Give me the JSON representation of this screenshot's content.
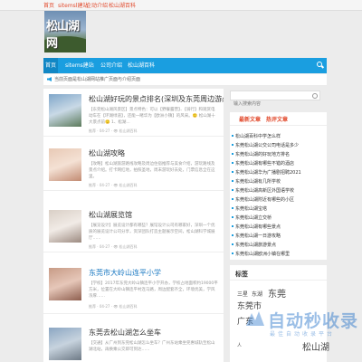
{
  "topbar": {
    "links": [
      "首页",
      "sitemsl建站",
      "企动介绍",
      "松山湖百科"
    ]
  },
  "logo": {
    "text": "松山湖网"
  },
  "nav": {
    "items": [
      "首页",
      "sitems建站",
      "公司介绍",
      "松山湖百科"
    ]
  },
  "notice": {
    "text": "当前页面是松山湖网站推广页面与介绍页面"
  },
  "posts": [
    {
      "title": "松山湖好玩的景点排名(深圳及东莞周边游必看)",
      "excerpt": "【东莞松山湖风景区】景点特色：可以【野餐露营】、【骑行】和观赏电动车在【环湖绿道】，还能一睹华为【欧洲小镇】的风采。🙂 松山湖十大景点前🙂 1、松湖...",
      "meta": "推荐 · 04-27 · 👁 松山湖百科"
    },
    {
      "title": "松山湖攻略",
      "excerpt": "【攻略】松山湖旅游路线攻略及周边住宿推荐与美食介绍，游玩路线及景点介绍。打卡网红地，拍照圣地，周末游玩好去处，门票信息全在这里。",
      "meta": "推荐 · 04-27 · 👁 松山湖百科"
    },
    {
      "title": "松山湖展览馆",
      "excerpt": "【展览设计】展览设计都有哪些？展馆设计公司有哪家好，深圳一个优质的展览设计公司分享，资深团队打造主题展示空间，松山湖科学城展厅……",
      "meta": "推荐 · 04-27 · 👁 松山湖百科"
    },
    {
      "title": "东莞市大岭山连平小学",
      "excerpt": "【学校】2017年东莞大岭山镇连平小学开办，学校占地面积约19000平方米，位置在大岭山镇连平村连马路，周边配套齐全，环境优美，学风浓厚……",
      "meta": "推荐 · 04-27 · 👁 松山湖百科"
    },
    {
      "title": "东莞去松山湖怎么坐车",
      "excerpt": "【交通】从广州到东莞松山湖怎么坐车？广州东站乘坐莞惠城轨至松山湖北站，再换乘公交即可到达……",
      "meta": "推荐 · 04-27 · 👁 松山湖百科"
    }
  ],
  "sidebar": {
    "search_placeholder": "输入搜索内容",
    "tabs": [
      "最新文章",
      "热评文章"
    ],
    "list": [
      "松山湖百科中学怎么样",
      "东莞松山湖公交公司电话是多少",
      "东莞松山湖的好玩地方排名",
      "东莞松山湖有哪些不错的酒店",
      "东莞松山湖华为广播剧招聘2021",
      "东莞松山湖有几所学校",
      "东莞松山湖高新区外国语学校",
      "东莞松山湖附近有哪些的小区",
      "东莞松山湖宝塔",
      "东莞松山湖立交桥",
      "东莞松山湖有哪些景点",
      "东莞松山湖一日游攻略",
      "东莞松山湖旅游景点",
      "东莞松山湖欧洲小镇在哪里"
    ],
    "tags_title": "标签",
    "tags": [
      "三星",
      "东湖",
      "东莞",
      "东莞市",
      "中国",
      "中国人",
      "交通",
      "人",
      "人工",
      "人",
      "大岭山",
      "中学",
      "广东",
      "松山湖"
    ]
  },
  "watermark": {
    "text": "自动秒收录",
    "sub": "最佳自动收录平台"
  },
  "colors": {
    "accent": "#1a9ee0",
    "link": "#e24b2e"
  }
}
